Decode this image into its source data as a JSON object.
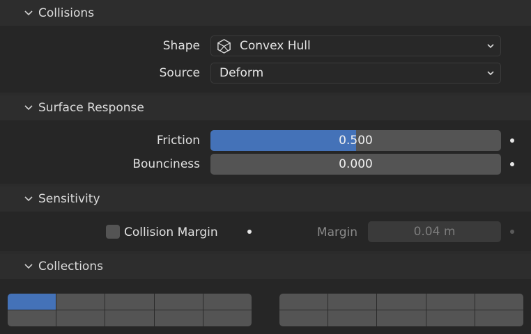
{
  "panels": {
    "collisions": {
      "title": "Collisions"
    },
    "surface_response": {
      "title": "Surface Response"
    },
    "sensitivity": {
      "title": "Sensitivity"
    },
    "collections": {
      "title": "Collections"
    }
  },
  "collisions": {
    "shape_label": "Shape",
    "shape_value": "Convex Hull",
    "shape_icon": "convex-hull-icon",
    "source_label": "Source",
    "source_value": "Deform"
  },
  "surface_response": {
    "friction_label": "Friction",
    "friction_value": "0.500",
    "friction_fraction": 0.5,
    "bounciness_label": "Bounciness",
    "bounciness_value": "0.000",
    "bounciness_fraction": 0.0
  },
  "sensitivity": {
    "collision_margin_label": "Collision Margin",
    "collision_margin_checked": false,
    "margin_label": "Margin",
    "margin_value": "0.04 m"
  },
  "collections": {
    "group_1_active_index": 0,
    "group_2_active_index": null
  },
  "colors": {
    "accent": "#4472b8",
    "background": "#2b2b2b",
    "field": "#545454"
  }
}
